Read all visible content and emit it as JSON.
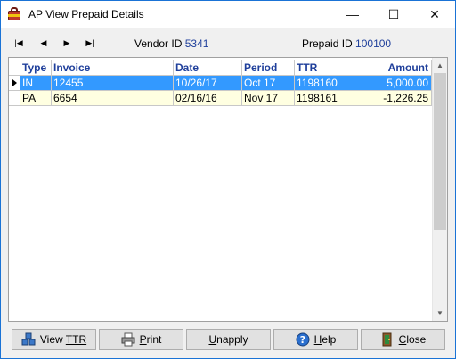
{
  "window": {
    "title": "AP View Prepaid Details",
    "controls": {
      "minimize": "—",
      "maximize": "☐",
      "close": "✕"
    }
  },
  "toolbar": {
    "nav": {
      "first": "|◀",
      "prev": "◀",
      "next": "▶",
      "last": "▶|"
    },
    "vendor_label": "Vendor ID",
    "vendor_id": "5341",
    "prepaid_label": "Prepaid ID",
    "prepaid_id": "100100"
  },
  "grid": {
    "columns": {
      "type": "Type",
      "invoice": "Invoice",
      "date": "Date",
      "period": "Period",
      "ttr": "TTR",
      "amount": "Amount"
    },
    "rows": [
      {
        "type": "IN",
        "invoice": "12455",
        "date": "10/26/17",
        "period": "Oct 17",
        "ttr": "1198160",
        "amount": "5,000.00",
        "selected": true
      },
      {
        "type": "PA",
        "invoice": "6654",
        "date": "02/16/16",
        "period": "Nov 17",
        "ttr": "1198161",
        "amount": "-1,226.25",
        "selected": false
      }
    ]
  },
  "buttons": {
    "view_ttr_prefix": "View ",
    "view_ttr_underlined": "TTR",
    "print": "Print",
    "unapply": "Unapply",
    "help": "Help",
    "close": "Close"
  },
  "colors": {
    "selection": "#3399ff",
    "alt_row": "#ffffe1",
    "header_text": "#1f3f9b"
  }
}
